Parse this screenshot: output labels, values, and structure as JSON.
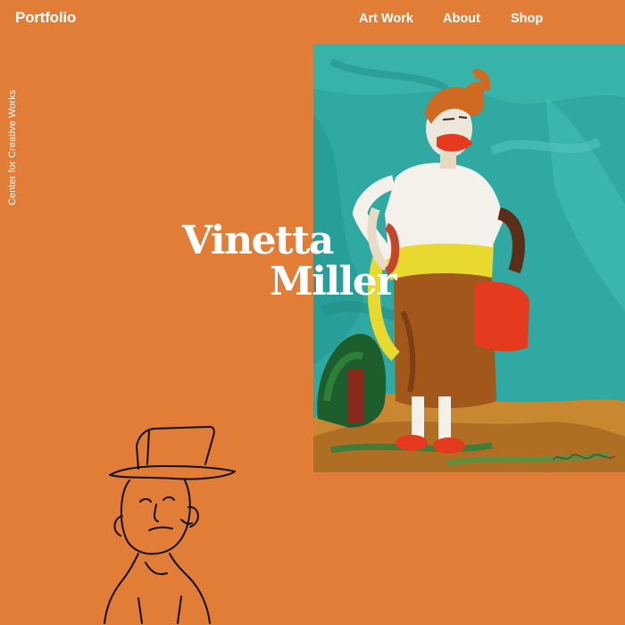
{
  "brand": {
    "logo": "Portfolio"
  },
  "nav": {
    "items": [
      {
        "label": "Art Work"
      },
      {
        "label": "About"
      },
      {
        "label": "Shop"
      }
    ]
  },
  "side_label": "Center for Creative Works",
  "artist": {
    "first_name": "Vinetta",
    "last_name": "Miller"
  },
  "colors": {
    "background": "#E27D38",
    "text": "#FFFFFF",
    "painting_background": "#2FA9A2"
  },
  "icons": {
    "painting": "artwork-painting-woman",
    "sketch": "line-drawing-man-hat"
  }
}
